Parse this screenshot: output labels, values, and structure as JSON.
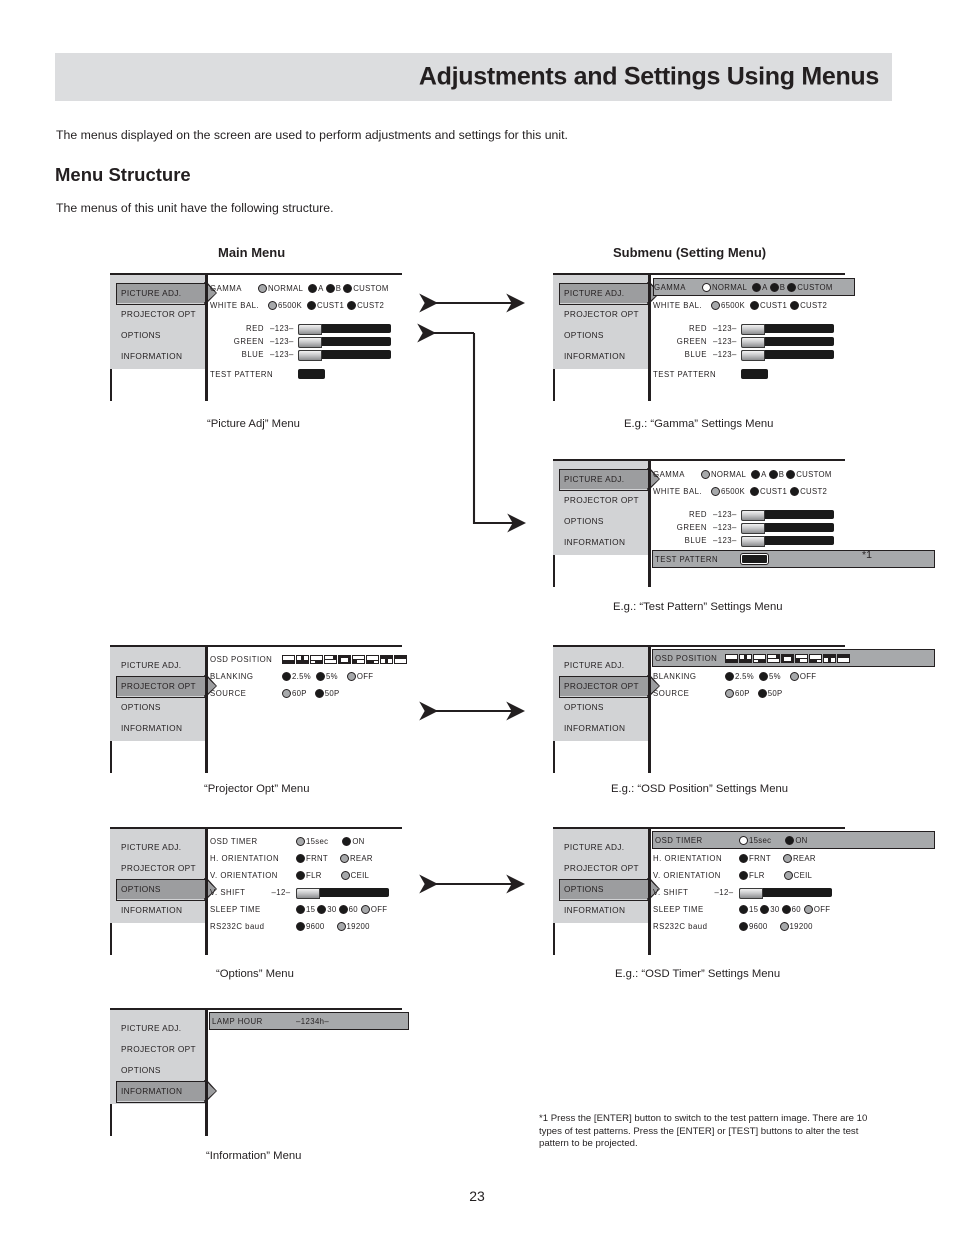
{
  "header": {
    "title": "Adjustments and Settings Using Menus"
  },
  "intro": "The menus displayed on the screen are used to perform adjustments and settings for this unit.",
  "section": {
    "heading": "Menu Structure",
    "subtext": "The menus of this unit have the following structure."
  },
  "columns": {
    "left": "Main Menu",
    "right": "Submenu (Setting Menu)"
  },
  "sidebar_items": [
    "PICTURE ADJ.",
    "PROJECTOR OPT",
    "OPTIONS",
    "INFORMATION"
  ],
  "labels": {
    "gamma": "GAMMA",
    "white_bal": "WHITE BAL.",
    "red": "RED",
    "green": "GREEN",
    "blue": "BLUE",
    "test_pattern": "TEST PATTERN",
    "osd_position": "OSD POSITION",
    "blanking": "BLANKING",
    "source": "SOURCE",
    "osd_timer": "OSD TIMER",
    "h_orientation": "H. ORIENTATION",
    "v_orientation": "V. ORIENTATION",
    "v_shift": "V. SHIFT",
    "sleep_time": "SLEEP TIME",
    "rs232c_baud": "RS232C baud",
    "lamp_hour": "LAMP HOUR"
  },
  "options": {
    "gamma": [
      "NORMAL",
      "A",
      "B",
      "CUSTOM"
    ],
    "white_bal": [
      "6500K",
      "CUST1",
      "CUST2"
    ],
    "blanking": [
      "2.5%",
      "5%",
      "OFF"
    ],
    "source": [
      "60P",
      "50P"
    ],
    "osd_timer": [
      "15sec",
      "ON"
    ],
    "h_orientation": [
      "FRNT",
      "REAR"
    ],
    "v_orientation": [
      "FLR",
      "CEIL"
    ],
    "sleep_time": [
      "15",
      "30",
      "60",
      "OFF"
    ],
    "rs232c_baud": [
      "9600",
      "19200"
    ]
  },
  "values": {
    "red": "–123–",
    "green": "–123–",
    "blue": "–123–",
    "v_shift": "–12–",
    "lamp_hour": "–1234h–"
  },
  "captions": {
    "picture_adj": "“Picture Adj”  Menu",
    "gamma_settings": "E.g.: “Gamma” Settings Menu",
    "test_pattern_settings": "E.g.: “Test Pattern” Settings Menu",
    "projector_opt": "“Projector Opt”  Menu",
    "osd_position_settings": "E.g.: “OSD Position” Settings Menu",
    "options_menu": "“Options”  Menu",
    "osd_timer_settings": "E.g.: “OSD Timer” Settings Menu",
    "information_menu": "“Information”  Menu"
  },
  "annotations": {
    "star1": "*1"
  },
  "footnote": "*1 Press the [ENTER] button to switch to the test pattern image. There are 10 types of test patterns. Press the [ENTER] or [TEST] buttons to alter the test pattern to be projected.",
  "page_number": "23",
  "colors": {
    "band": "#dcdddf",
    "sidebar": "#d2d3d5",
    "selected": "#9c9d9f",
    "highlight_row": "#a7a9ab",
    "ink": "#231f20"
  }
}
